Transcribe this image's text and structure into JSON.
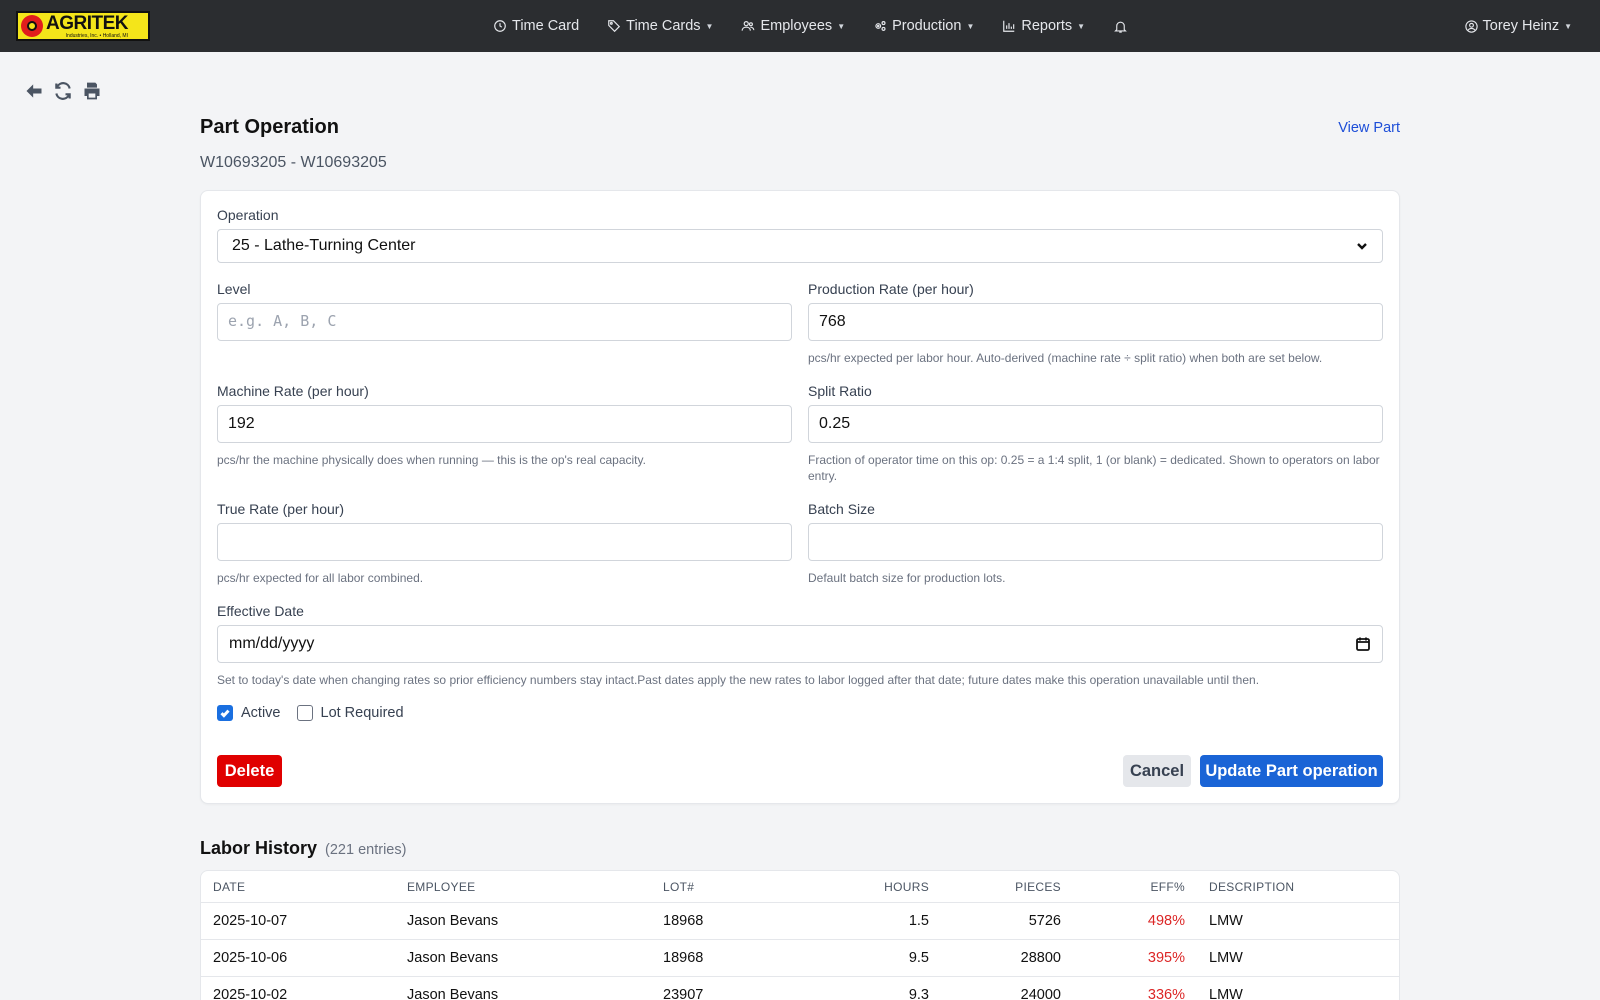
{
  "brand": {
    "name": "AGRITEK",
    "sub": "Industries, Inc. • Holland, MI"
  },
  "nav": {
    "items": [
      {
        "label": "Time Card",
        "icon": "clock-icon",
        "caret": false
      },
      {
        "label": "Time Cards",
        "icon": "tags-icon",
        "caret": true
      },
      {
        "label": "Employees",
        "icon": "users-icon",
        "caret": true
      },
      {
        "label": "Production",
        "icon": "cogs-icon",
        "caret": true
      },
      {
        "label": "Reports",
        "icon": "bar-chart-icon",
        "caret": true
      }
    ],
    "user": "Torey Heinz"
  },
  "page": {
    "title": "Part Operation",
    "subtitle": "W10693205 - W10693205",
    "view_part": "View Part"
  },
  "form": {
    "operation_label": "Operation",
    "operation_value": "25 - Lathe-Turning Center",
    "level_label": "Level",
    "level_placeholder": "e.g. A, B, C",
    "prod_rate_label": "Production Rate (per hour)",
    "prod_rate_value": "768",
    "prod_rate_help": "pcs/hr expected per labor hour. Auto-derived (machine rate ÷ split ratio) when both are set below.",
    "machine_rate_label": "Machine Rate (per hour)",
    "machine_rate_value": "192",
    "machine_rate_help": "pcs/hr the machine physically does when running — this is the op's real capacity.",
    "split_ratio_label": "Split Ratio",
    "split_ratio_value": "0.25",
    "split_ratio_help": "Fraction of operator time on this op: 0.25 = a 1:4 split, 1 (or blank) = dedicated. Shown to operators on labor entry.",
    "true_rate_label": "True Rate (per hour)",
    "true_rate_help": "pcs/hr expected for all labor combined.",
    "batch_label": "Batch Size",
    "batch_help": "Default batch size for production lots.",
    "eff_date_label": "Effective Date",
    "eff_date_value": "mm/dd/yyyy",
    "eff_date_help": "Set to today's date when changing rates so prior efficiency numbers stay intact.Past dates apply the new rates to labor logged after that date; future dates make this operation unavailable until then.",
    "active_label": "Active",
    "lot_required_label": "Lot Required",
    "delete_label": "Delete",
    "cancel_label": "Cancel",
    "update_label": "Update Part operation"
  },
  "labor": {
    "title": "Labor History",
    "count": "(221 entries)",
    "columns": [
      "DATE",
      "EMPLOYEE",
      "LOT#",
      "HOURS",
      "PIECES",
      "EFF%",
      "DESCRIPTION"
    ],
    "rows": [
      {
        "date": "2025-10-07",
        "employee": "Jason Bevans",
        "lot": "18968",
        "hours": "1.5",
        "pieces": "5726",
        "eff": "498%",
        "desc": "LMW"
      },
      {
        "date": "2025-10-06",
        "employee": "Jason Bevans",
        "lot": "18968",
        "hours": "9.5",
        "pieces": "28800",
        "eff": "395%",
        "desc": "LMW"
      },
      {
        "date": "2025-10-02",
        "employee": "Jason Bevans",
        "lot": "23907",
        "hours": "9.3",
        "pieces": "24000",
        "eff": "336%",
        "desc": "LMW"
      }
    ]
  }
}
